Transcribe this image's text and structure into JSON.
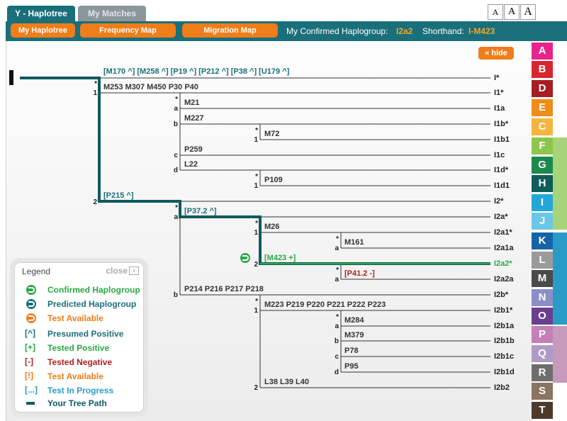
{
  "tabs": {
    "haplotree": "Y - Haplotree",
    "matches": "My Matches"
  },
  "font_sizes": [
    "A",
    "A",
    "A"
  ],
  "toolbar": {
    "my_haplotree": "My Haplotree",
    "frequency_map": "Frequency Map",
    "migration_map": "Migration Map",
    "confirmed_label": "My Confirmed Haplogroup:",
    "confirmed_value": "I2a2",
    "shorthand_label": "Shorthand:",
    "shorthand_value": "I-M423"
  },
  "hide_button": "hide",
  "tree": {
    "markers": {
      "root_presumed": "[M170 ^] [M258 ^] [P19 ^] [P212 ^] [P38 ^] [U179 ^]",
      "i1": "M253 M307 M450 P30 P40",
      "i1a": "M21",
      "i1b": "M227",
      "i1b1": "M72",
      "i1c": "P259",
      "i1d": "L22",
      "i1d1": "P109",
      "i2": "[P215 ^]",
      "i2a": "[P37.2 ^]",
      "i2a1": "M26",
      "i2a1a": "M161",
      "i2a2": "[M423 +]",
      "i2a2a": "[P41.2 -]",
      "i2b": "P214 P216 P217 P218",
      "i2b1": "M223 P219 P220 P221 P222 P223",
      "i2b1a": "M284",
      "i2b1b": "M379",
      "i2b1c": "P78",
      "i2b1d": "P95",
      "i2b2": "L38 L39 L40"
    },
    "branch_labels": {
      "star": "*",
      "one": "1",
      "two": "2",
      "a": "a",
      "b": "b",
      "c": "c",
      "d": "d"
    },
    "nodes": [
      "I*",
      "I1*",
      "I1a",
      "I1b*",
      "I1b1",
      "I1c",
      "I1d*",
      "I1d1",
      "I2*",
      "I2a*",
      "I2a1*",
      "I2a1a",
      "I2a2*",
      "I2a2a",
      "I2b*",
      "I2b1*",
      "I2b1a",
      "I2b1b",
      "I2b1c",
      "I2b1d",
      "I2b2"
    ]
  },
  "letters": [
    "A",
    "B",
    "D",
    "E",
    "C",
    "F",
    "G",
    "H",
    "I",
    "J",
    "K",
    "L",
    "M",
    "N",
    "O",
    "P",
    "Q",
    "R",
    "S",
    "T"
  ],
  "legend": {
    "title": "Legend",
    "close": "close",
    "items": [
      {
        "symbol": "confirmed-icon",
        "text": "Confirmed Haplogroup"
      },
      {
        "symbol": "predicted-icon",
        "text": "Predicted Haplogroup"
      },
      {
        "symbol": "test-available-icon",
        "text": "Test Available"
      },
      {
        "symbol": "[^]",
        "text": "Presumed Positive"
      },
      {
        "symbol": "[+]",
        "text": "Tested Positive"
      },
      {
        "symbol": "[-]",
        "text": "Tested Negative"
      },
      {
        "symbol": "[!]",
        "text": "Test Available"
      },
      {
        "symbol": "[...]",
        "text": "Test In Progress"
      },
      {
        "symbol": "path-line-icon",
        "text": "Your Tree Path"
      }
    ]
  },
  "colors": {
    "teal": "#1a6f7a",
    "orange": "#ef7d1a",
    "green": "#2aa844",
    "red": "#b21e1e",
    "blue": "#2a9bc7"
  }
}
